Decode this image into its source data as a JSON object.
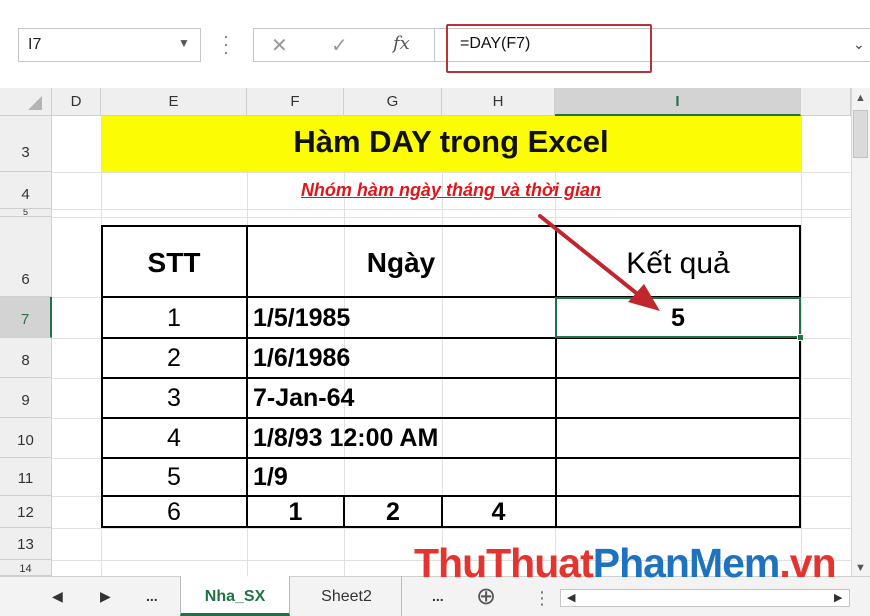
{
  "formula_bar": {
    "name_box": "I7",
    "cancel_glyph": "✕",
    "enter_glyph": "✓",
    "fx_label": "fx",
    "formula": "=DAY(F7)",
    "expand_glyph": "⌄"
  },
  "columns": [
    "D",
    "E",
    "F",
    "G",
    "H",
    "I"
  ],
  "rows": [
    "3",
    "4",
    "5",
    "6",
    "7",
    "8",
    "9",
    "10",
    "11",
    "12",
    "13",
    "14"
  ],
  "sheet": {
    "title": "Hàm DAY trong Excel",
    "subtitle": "Nhóm hàm ngày tháng và thời gian",
    "headers": {
      "stt": "STT",
      "date": "Ngày",
      "result": "Kết quả"
    },
    "data_rows": [
      {
        "stt": "1",
        "date": "1/5/1985",
        "result": "5"
      },
      {
        "stt": "2",
        "date": "1/6/1986",
        "result": ""
      },
      {
        "stt": "3",
        "date": "7-Jan-64",
        "result": ""
      },
      {
        "stt": "4",
        "date": "1/8/93 12:00 AM",
        "result": ""
      },
      {
        "stt": "5",
        "date": "1/9",
        "result": ""
      },
      {
        "stt": "6",
        "date": "",
        "result": "",
        "split": [
          "1",
          "2",
          "4"
        ]
      }
    ]
  },
  "tabs": {
    "prev": "◀",
    "next": "▶",
    "more_left": "...",
    "active": "Nha_SX",
    "other": "Sheet2",
    "more_right": "...",
    "add": "⊕",
    "dots": "⋮"
  },
  "watermark": {
    "part1": "ThuThuat",
    "part2": "PhanMem",
    "part3": ".vn"
  },
  "colors": {
    "accent": "#217346",
    "title_fill": "#fcfc04",
    "subtitle": "#e0161b",
    "arrow": "#c0262d"
  }
}
